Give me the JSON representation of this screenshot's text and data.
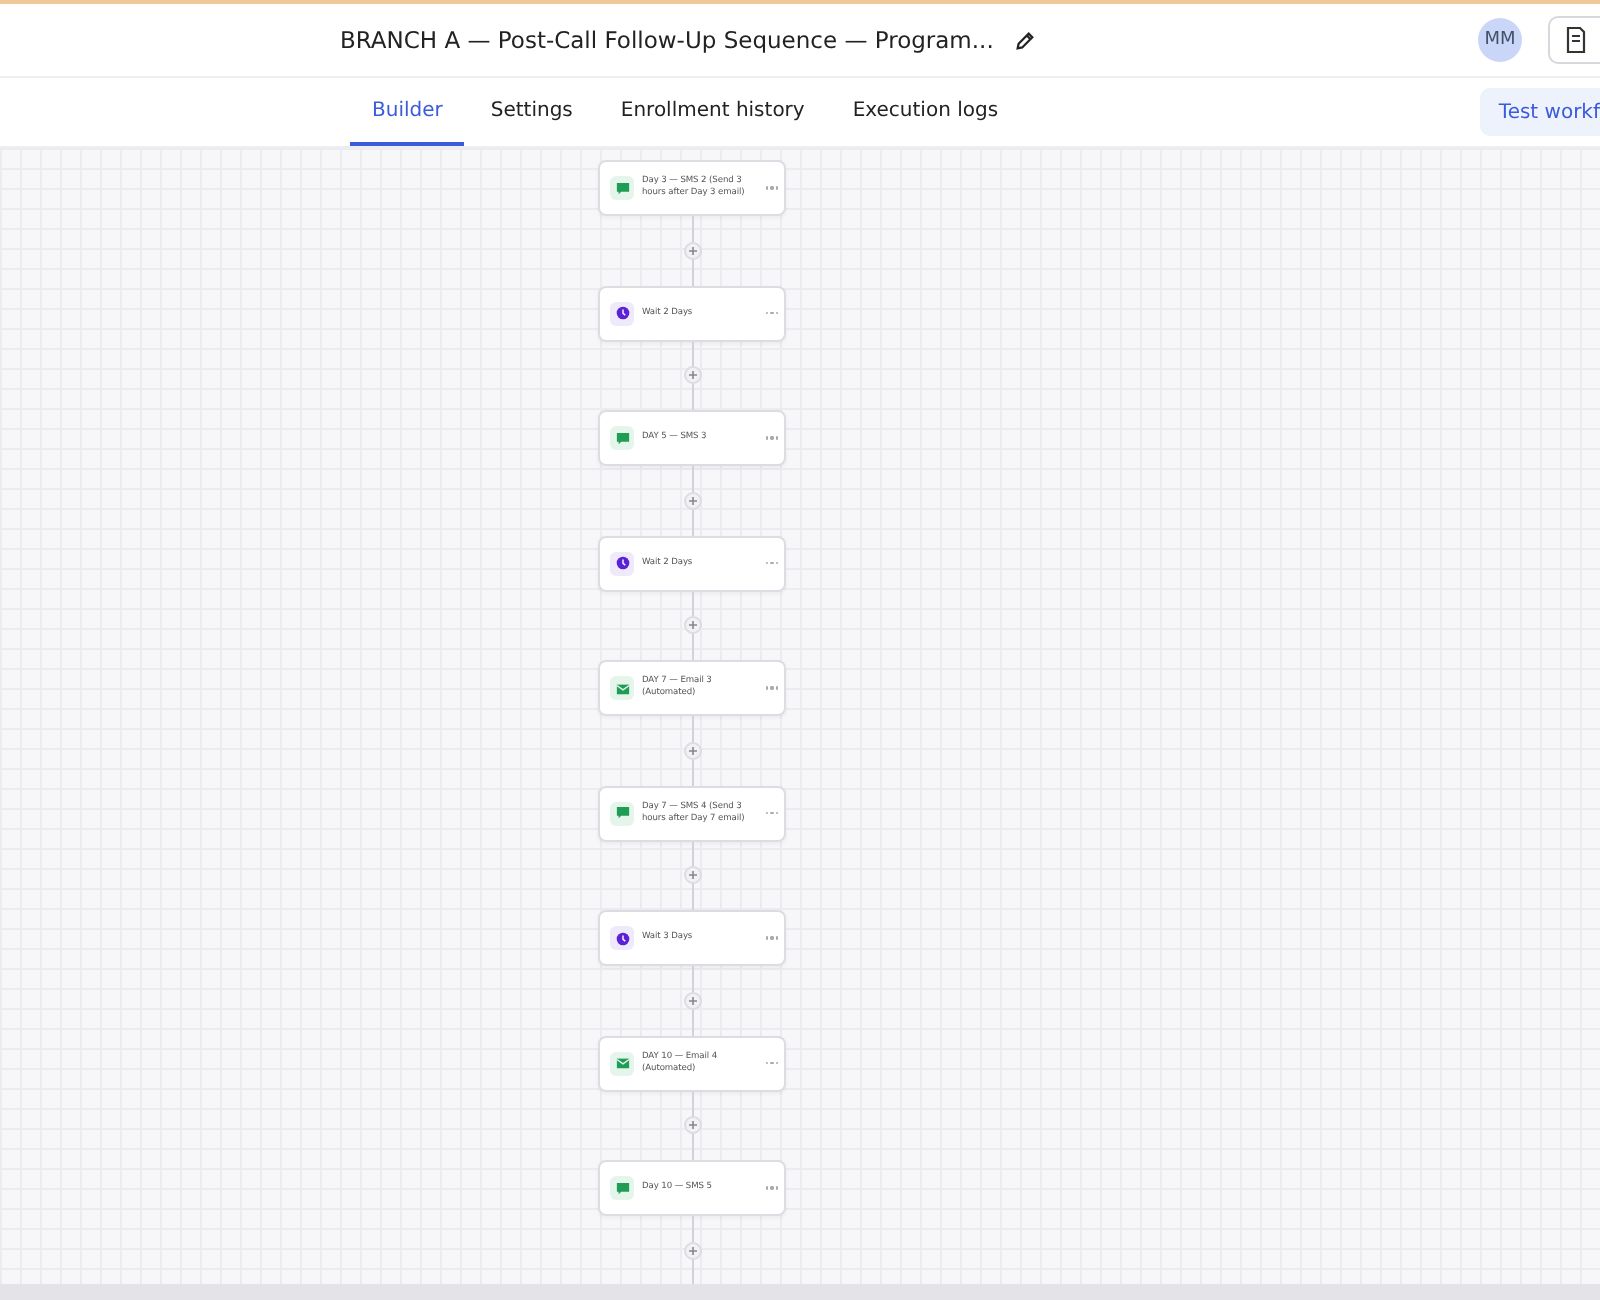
{
  "header": {
    "title": "BRANCH A — Post-Call Follow-Up Sequence — Program...",
    "avatar": "MM"
  },
  "tabs": [
    {
      "label": "Builder",
      "selected": true
    },
    {
      "label": "Settings",
      "selected": false
    },
    {
      "label": "Enrollment history",
      "selected": false
    },
    {
      "label": "Execution logs",
      "selected": false
    }
  ],
  "test_button": "Test workf",
  "nodes": [
    {
      "kind": "sms",
      "label": "Day 3 — SMS 2 (Send 3 hours after Day 3 email)"
    },
    {
      "kind": "wait",
      "label": "Wait 2 Days"
    },
    {
      "kind": "sms",
      "label": "DAY 5 — SMS 3"
    },
    {
      "kind": "wait",
      "label": "Wait 2 Days"
    },
    {
      "kind": "email",
      "label": "DAY 7 — Email 3 (Automated)"
    },
    {
      "kind": "sms",
      "label": "Day 7 — SMS 4 (Send 3 hours after Day 7 email)"
    },
    {
      "kind": "wait",
      "label": "Wait 3 Days"
    },
    {
      "kind": "email",
      "label": "DAY 10 — Email 4 (Automated)"
    },
    {
      "kind": "sms",
      "label": "Day 10 — SMS 5"
    }
  ]
}
